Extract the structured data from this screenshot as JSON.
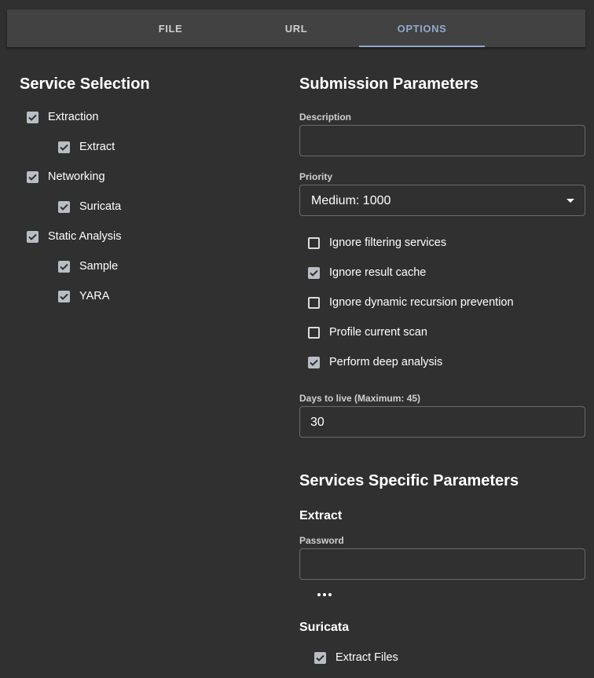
{
  "tabs": [
    {
      "label": "FILE"
    },
    {
      "label": "URL"
    },
    {
      "label": "OPTIONS"
    }
  ],
  "active_tab": "OPTIONS",
  "accent_color": "#90a8cf",
  "service_selection": {
    "title": "Service Selection",
    "groups": [
      {
        "label": "Extraction",
        "checked": true,
        "children": [
          {
            "label": "Extract",
            "checked": true
          }
        ]
      },
      {
        "label": "Networking",
        "checked": true,
        "children": [
          {
            "label": "Suricata",
            "checked": true
          }
        ]
      },
      {
        "label": "Static Analysis",
        "checked": true,
        "children": [
          {
            "label": "Sample",
            "checked": true
          },
          {
            "label": "YARA",
            "checked": true
          }
        ]
      }
    ]
  },
  "submission": {
    "title": "Submission Parameters",
    "description_label": "Description",
    "description_value": "",
    "priority_label": "Priority",
    "priority_value": "Medium: 1000",
    "options": [
      {
        "label": "Ignore filtering services",
        "checked": false
      },
      {
        "label": "Ignore result cache",
        "checked": true
      },
      {
        "label": "Ignore dynamic recursion prevention",
        "checked": false
      },
      {
        "label": "Profile current scan",
        "checked": false
      },
      {
        "label": "Perform deep analysis",
        "checked": true
      }
    ],
    "ttl_label": "Days to live (Maximum: 45)",
    "ttl_value": "30"
  },
  "service_params": {
    "title": "Services Specific Parameters",
    "extract": {
      "title": "Extract",
      "password_label": "Password",
      "password_value": "",
      "more_icon": "more-horizontal-icon"
    },
    "suricata": {
      "title": "Suricata",
      "extract_files_label": "Extract Files",
      "extract_files_checked": true
    }
  }
}
